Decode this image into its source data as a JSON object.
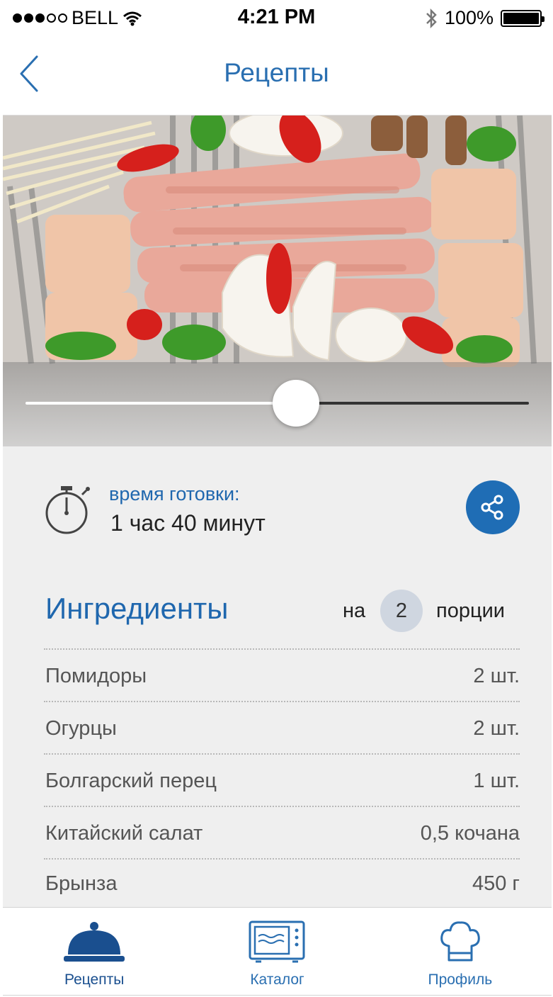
{
  "status_bar": {
    "carrier": "BELL",
    "time": "4:21 PM",
    "battery": "100%",
    "signal_bars_filled": 3,
    "signal_bars_total": 5
  },
  "nav": {
    "title": "Рецепты",
    "back_icon": "chevron-left-icon"
  },
  "hero": {
    "image_subject": "raw meat, vegetables and mushrooms on a grill",
    "slider_position": 0.52
  },
  "cooking": {
    "label": "время готовки:",
    "value": "1 час 40 минут",
    "timer_icon": "stopwatch-icon",
    "share_icon": "share-icon"
  },
  "ingredients": {
    "title": "Ингредиенты",
    "portion_prefix": "на",
    "portion_count": "2",
    "portion_suffix": "порции",
    "items": [
      {
        "name": "Помидоры",
        "amount": "2 шт."
      },
      {
        "name": "Огурцы",
        "amount": "2 шт."
      },
      {
        "name": "Болгарский перец",
        "amount": "1 шт."
      },
      {
        "name": "Китайский салат",
        "amount": "0,5 кочана"
      },
      {
        "name": "Брынза",
        "amount": "450 г"
      }
    ]
  },
  "tabs": [
    {
      "label": "Рецепты",
      "icon": "cloche-icon",
      "active": true
    },
    {
      "label": "Каталог",
      "icon": "microwave-icon",
      "active": false
    },
    {
      "label": "Профиль",
      "icon": "chef-hat-icon",
      "active": false
    }
  ],
  "colors": {
    "accent": "#1f6db5",
    "title_blue": "#2a6fb1",
    "content_bg": "#efefef"
  }
}
